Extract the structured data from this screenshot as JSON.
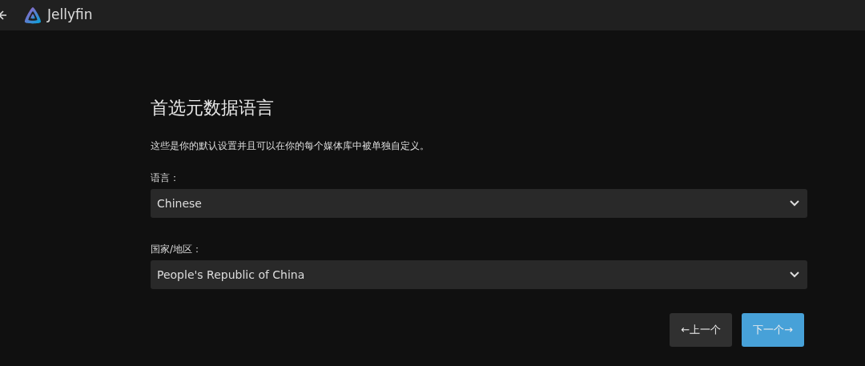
{
  "header": {
    "app_name": "Jellyfin"
  },
  "title": "首选元数据语言",
  "description": "这些是你的默认设置并且可以在你的每个媒体库中被单独自定义。",
  "fields": [
    {
      "label": "语言：",
      "value": "Chinese"
    },
    {
      "label": "国家/地区：",
      "value": "People's Republic of China"
    }
  ],
  "buttons": [
    {
      "label": "←上一个",
      "kind": "secondary"
    },
    {
      "label": "下一个→",
      "kind": "primary"
    }
  ]
}
